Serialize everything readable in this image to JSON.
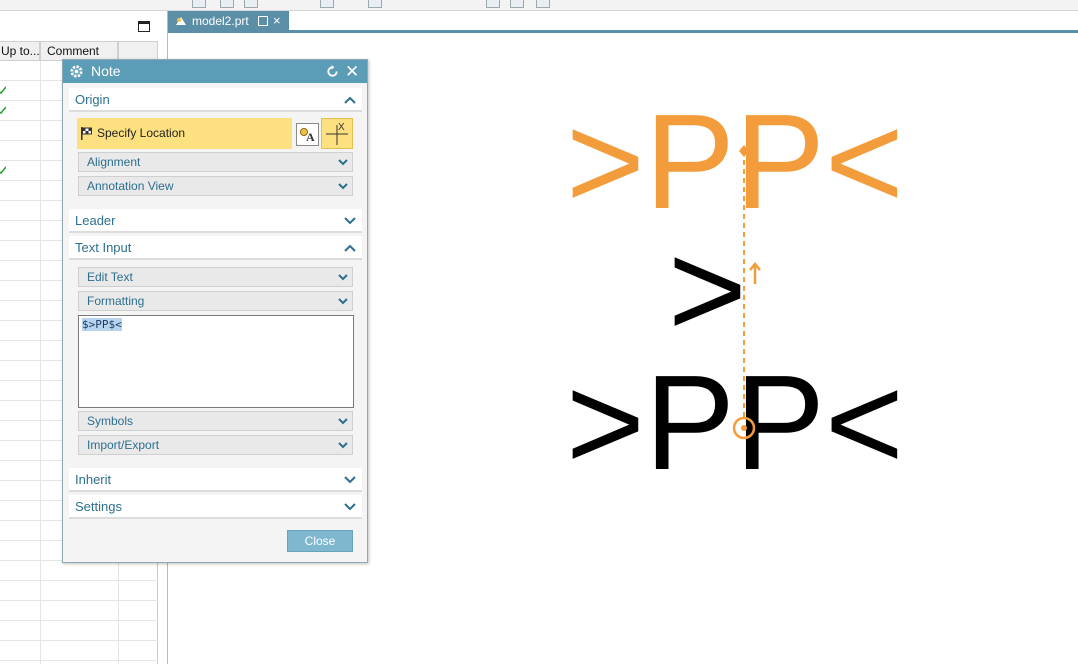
{
  "colors": {
    "accent": "#5b9cb6",
    "highlight": "#fde180",
    "preview": "#f39c3c",
    "text_link": "#2c6f8f"
  },
  "navigator": {
    "columns": [
      "Up to...",
      "Comment",
      ""
    ],
    "rows_with_check": [
      2,
      3,
      6
    ]
  },
  "tab": {
    "label": "model2.prt",
    "close_glyph": "×"
  },
  "dialog": {
    "title": "Note",
    "origin": {
      "label": "Origin",
      "specify_location": "Specify Location",
      "alignment": "Alignment",
      "annotation_view": "Annotation View"
    },
    "leader": "Leader",
    "text_input": {
      "label": "Text Input",
      "edit_text": "Edit Text",
      "formatting": "Formatting",
      "value": "$>PP$<",
      "symbols": "Symbols",
      "import_export": "Import/Export"
    },
    "inherit": "Inherit",
    "settings": "Settings",
    "close_label": "Close"
  },
  "canvas": {
    "preview_text": ">PP<",
    "placed_text_top": ">",
    "placed_text_bottom": ">PP<"
  }
}
